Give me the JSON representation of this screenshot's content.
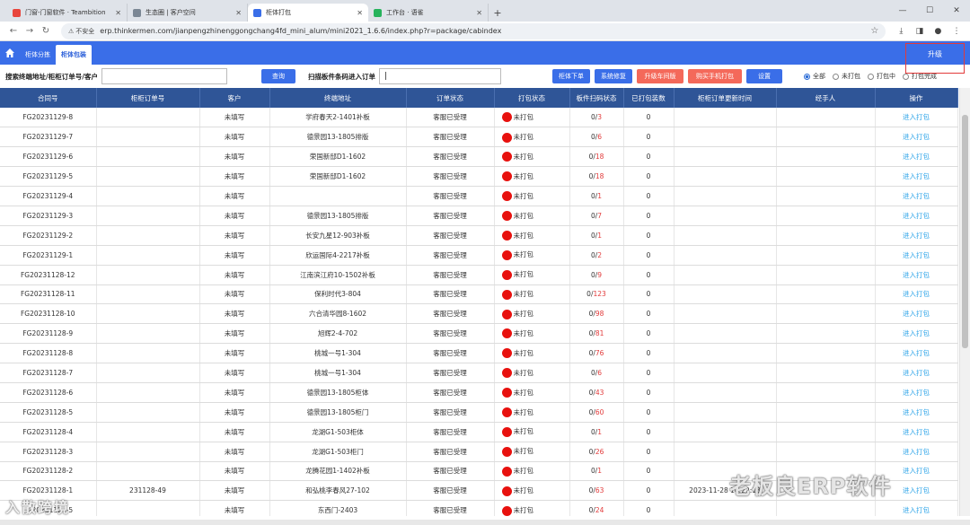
{
  "browser": {
    "tabs": [
      {
        "title": "门窗-门窗软件 · Teambition",
        "fav": "#e8453c",
        "active": false
      },
      {
        "title": "生态圈 | 客户空间",
        "fav": "#7b8794",
        "active": false
      },
      {
        "title": "柜体打包",
        "fav": "#3a6ee8",
        "active": true
      },
      {
        "title": "工作台 · 语雀",
        "fav": "#27b35c",
        "active": false
      }
    ],
    "new_tab": "+",
    "warning": "不安全",
    "url": "erp.thinkermen.com/jianpengzhinenggongchang4fd_mini_alum/mini2021_1.6.6/index.php?r=package/cabindex"
  },
  "app": {
    "tabs": [
      "柜体分拣",
      "柜体包装"
    ],
    "active_tab": 1,
    "upgrade_label": "升级"
  },
  "filter": {
    "search_label": "搜索终端地址/柜柜订单号/客户",
    "query_button": "查询",
    "scan_label": "扫描板件条码进入订单",
    "scan_value": "|",
    "buttons": [
      {
        "label": "柜体下单",
        "style": "blue"
      },
      {
        "label": "系统修复",
        "style": "blue"
      },
      {
        "label": "升级车间版",
        "style": "red"
      },
      {
        "label": "购买手机打包",
        "style": "red"
      },
      {
        "label": "设置",
        "style": "blue"
      }
    ],
    "radios": [
      {
        "label": "全部",
        "checked": true
      },
      {
        "label": "未打包",
        "checked": false
      },
      {
        "label": "打包中",
        "checked": false
      },
      {
        "label": "打包完成",
        "checked": false
      }
    ]
  },
  "table": {
    "headers": [
      "合同号",
      "柜柜订单号",
      "客户",
      "终端地址",
      "订单状态",
      "打包状态",
      "板件扫码状态",
      "已打包装数",
      "柜柜订单更新时间",
      "经手人",
      "操作"
    ],
    "rows": [
      {
        "contract": "FG20231129-8",
        "order": "",
        "customer": "未填写",
        "address": "学府春天2-1401补板",
        "status": "客服已受理",
        "pack": "未打包",
        "scanned": "0",
        "total": "3",
        "packed": "0",
        "updated": "",
        "handler": "",
        "action": "进入打包"
      },
      {
        "contract": "FG20231129-7",
        "order": "",
        "customer": "未填写",
        "address": "德景园13-1805排版",
        "status": "客服已受理",
        "pack": "未打包",
        "scanned": "0",
        "total": "6",
        "packed": "0",
        "updated": "",
        "handler": "",
        "action": "进入打包"
      },
      {
        "contract": "FG20231129-6",
        "order": "",
        "customer": "未填写",
        "address": "荣国新邸D1-1602",
        "status": "客服已受理",
        "pack": "未打包",
        "scanned": "0",
        "total": "18",
        "packed": "0",
        "updated": "",
        "handler": "",
        "action": "进入打包"
      },
      {
        "contract": "FG20231129-5",
        "order": "",
        "customer": "未填写",
        "address": "荣国新邸D1-1602",
        "status": "客服已受理",
        "pack": "未打包",
        "scanned": "0",
        "total": "18",
        "packed": "0",
        "updated": "",
        "handler": "",
        "action": "进入打包"
      },
      {
        "contract": "FG20231129-4",
        "order": "",
        "customer": "未填写",
        "address": "",
        "status": "客服已受理",
        "pack": "未打包",
        "scanned": "0",
        "total": "1",
        "packed": "0",
        "updated": "",
        "handler": "",
        "action": "进入打包"
      },
      {
        "contract": "FG20231129-3",
        "order": "",
        "customer": "未填写",
        "address": "德景园13-1805排版",
        "status": "客服已受理",
        "pack": "未打包",
        "scanned": "0",
        "total": "7",
        "packed": "0",
        "updated": "",
        "handler": "",
        "action": "进入打包"
      },
      {
        "contract": "FG20231129-2",
        "order": "",
        "customer": "未填写",
        "address": "长安九星12-903补板",
        "status": "客服已受理",
        "pack": "未打包",
        "scanned": "0",
        "total": "1",
        "packed": "0",
        "updated": "",
        "handler": "",
        "action": "进入打包"
      },
      {
        "contract": "FG20231129-1",
        "order": "",
        "customer": "未填写",
        "address": "欣运国际4-2217补板",
        "status": "客服已受理",
        "pack": "未打包",
        "scanned": "0",
        "total": "2",
        "packed": "0",
        "updated": "",
        "handler": "",
        "action": "进入打包"
      },
      {
        "contract": "FG20231128-12",
        "order": "",
        "customer": "未填写",
        "address": "江南滨江府10-1502补板",
        "status": "客服已受理",
        "pack": "未打包",
        "scanned": "0",
        "total": "9",
        "packed": "0",
        "updated": "",
        "handler": "",
        "action": "进入打包"
      },
      {
        "contract": "FG20231128-11",
        "order": "",
        "customer": "未填写",
        "address": "保利时代3-804",
        "status": "客服已受理",
        "pack": "未打包",
        "scanned": "0",
        "total": "123",
        "packed": "0",
        "updated": "",
        "handler": "",
        "action": "进入打包"
      },
      {
        "contract": "FG20231128-10",
        "order": "",
        "customer": "未填写",
        "address": "六合清华园8-1602",
        "status": "客服已受理",
        "pack": "未打包",
        "scanned": "0",
        "total": "98",
        "packed": "0",
        "updated": "",
        "handler": "",
        "action": "进入打包"
      },
      {
        "contract": "FG20231128-9",
        "order": "",
        "customer": "未填写",
        "address": "旭辉2-4-702",
        "status": "客服已受理",
        "pack": "未打包",
        "scanned": "0",
        "total": "81",
        "packed": "0",
        "updated": "",
        "handler": "",
        "action": "进入打包"
      },
      {
        "contract": "FG20231128-8",
        "order": "",
        "customer": "未填写",
        "address": "桃城一号1-304",
        "status": "客服已受理",
        "pack": "未打包",
        "scanned": "0",
        "total": "76",
        "packed": "0",
        "updated": "",
        "handler": "",
        "action": "进入打包"
      },
      {
        "contract": "FG20231128-7",
        "order": "",
        "customer": "未填写",
        "address": "桃城一号1-304",
        "status": "客服已受理",
        "pack": "未打包",
        "scanned": "0",
        "total": "6",
        "packed": "0",
        "updated": "",
        "handler": "",
        "action": "进入打包"
      },
      {
        "contract": "FG20231128-6",
        "order": "",
        "customer": "未填写",
        "address": "德景园13-1805柜体",
        "status": "客服已受理",
        "pack": "未打包",
        "scanned": "0",
        "total": "43",
        "packed": "0",
        "updated": "",
        "handler": "",
        "action": "进入打包"
      },
      {
        "contract": "FG20231128-5",
        "order": "",
        "customer": "未填写",
        "address": "德景园13-1805柜门",
        "status": "客服已受理",
        "pack": "未打包",
        "scanned": "0",
        "total": "60",
        "packed": "0",
        "updated": "",
        "handler": "",
        "action": "进入打包"
      },
      {
        "contract": "FG20231128-4",
        "order": "",
        "customer": "未填写",
        "address": "龙湖G1-503柜体",
        "status": "客服已受理",
        "pack": "未打包",
        "scanned": "0",
        "total": "1",
        "packed": "0",
        "updated": "",
        "handler": "",
        "action": "进入打包"
      },
      {
        "contract": "FG20231128-3",
        "order": "",
        "customer": "未填写",
        "address": "龙湖G1-503柜门",
        "status": "客服已受理",
        "pack": "未打包",
        "scanned": "0",
        "total": "26",
        "packed": "0",
        "updated": "",
        "handler": "",
        "action": "进入打包"
      },
      {
        "contract": "FG20231128-2",
        "order": "",
        "customer": "未填写",
        "address": "龙腾花园1-1402补板",
        "status": "客服已受理",
        "pack": "未打包",
        "scanned": "0",
        "total": "1",
        "packed": "0",
        "updated": "",
        "handler": "",
        "action": "进入打包"
      },
      {
        "contract": "FG20231128-1",
        "order": "231128-49",
        "customer": "未填写",
        "address": "和弘桃李春风27-102",
        "status": "客服已受理",
        "pack": "未打包",
        "scanned": "0",
        "total": "63",
        "packed": "0",
        "updated": "2023-11-28 14:22:13",
        "handler": "",
        "action": "进入打包"
      },
      {
        "contract": "FG20231127-5",
        "order": "",
        "customer": "未填写",
        "address": "东西门-2403",
        "status": "客服已受理",
        "pack": "未打包",
        "scanned": "0",
        "total": "24",
        "packed": "0",
        "updated": "",
        "handler": "",
        "action": "进入打包"
      }
    ]
  },
  "watermarks": {
    "left": "入散跨境",
    "right": "老板良ERP软件"
  }
}
